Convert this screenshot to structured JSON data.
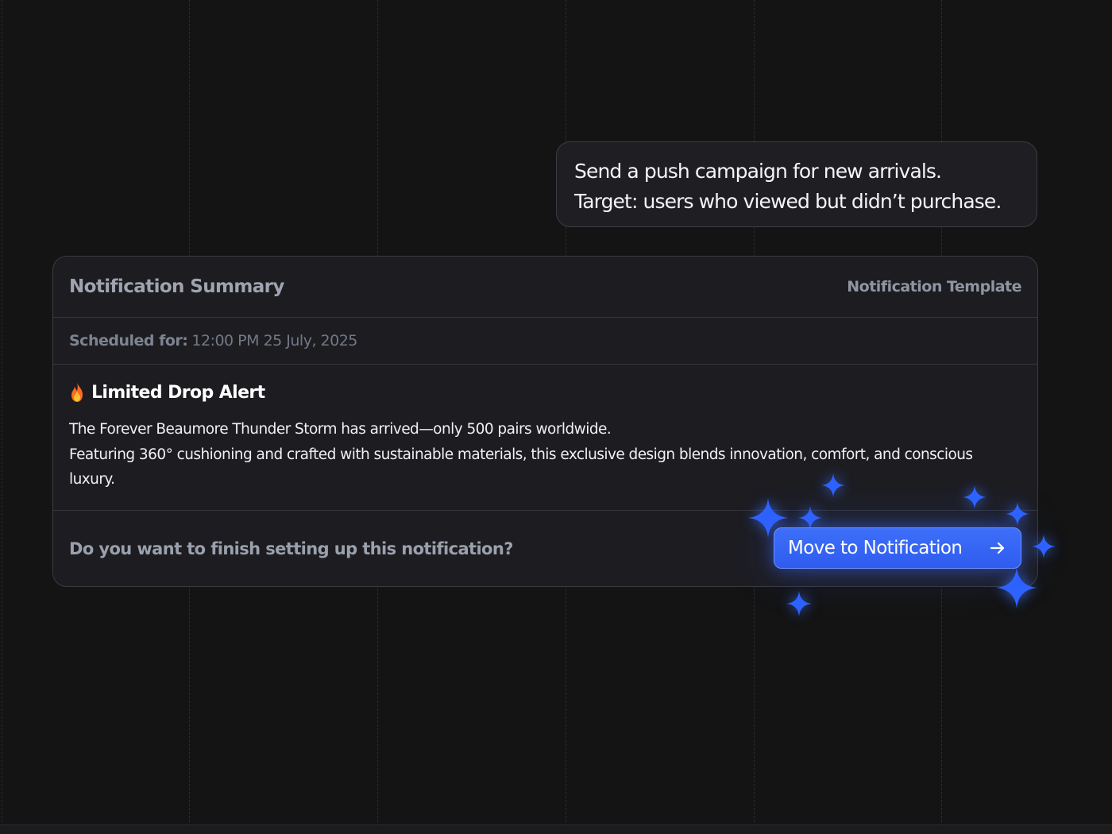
{
  "prompt_bubble": {
    "line1": "Send a push campaign for new arrivals.",
    "line2": "Target: users who viewed but didn’t purchase."
  },
  "summary_card": {
    "title": "Notification Summary",
    "template_link": "Notification Template",
    "scheduled_label": "Scheduled for:",
    "scheduled_value": "12:00 PM 25 July, 2025",
    "alert_icon": "flame-icon",
    "alert_title": "Limited Drop Alert",
    "alert_body": "The Forever Beaumore Thunder Storm has arrived—only 500 pairs worldwide.\n Featuring 360° cushioning and crafted with sustainable materials, this exclusive design blends innovation, comfort, and conscious luxury.",
    "question": "Do you want to finish setting up this notification?",
    "cta_label": "Move to Notification",
    "cta_icon": "arrow-right-icon"
  },
  "colors": {
    "background": "#141414",
    "card": "#1d1d21",
    "accent": "#3563f4",
    "sparkle": "#2e63ff"
  }
}
